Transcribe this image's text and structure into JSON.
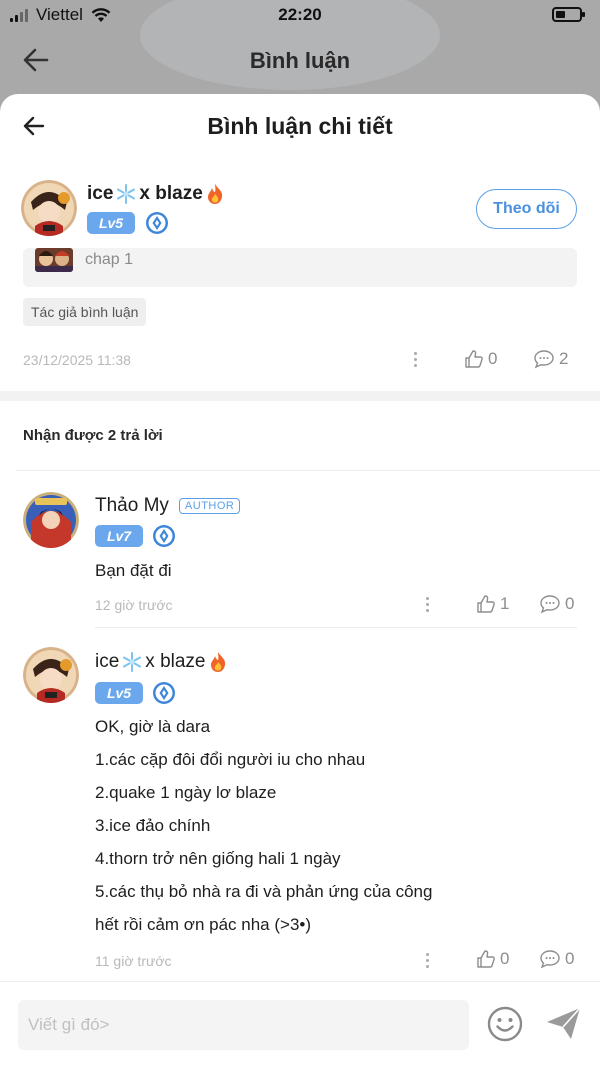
{
  "status_bar": {
    "carrier": "Viettel",
    "time": "22:20"
  },
  "background_page": {
    "title": "Bình luận"
  },
  "sheet": {
    "title": "Bình luận chi tiết"
  },
  "main_comment": {
    "user_name_a": "ice",
    "user_name_b": "x blaze",
    "level": "Lv5",
    "follow_label": "Theo dõi",
    "chapter_text": "chap 1",
    "tag": "Tác giả bình luận",
    "timestamp": "23/12/2025 11:38",
    "likes": "0",
    "replies": "2"
  },
  "replies_header": "Nhận được 2 trả lời",
  "replies": [
    {
      "user_name": "Thảo My",
      "author_badge": "AUTHOR",
      "level": "Lv7",
      "lines": [
        "Bạn đặt đi"
      ],
      "time": "12 giờ trước",
      "likes": "1",
      "replies": "0"
    },
    {
      "user_name_a": "ice",
      "user_name_b": "x blaze",
      "level": "Lv5",
      "lines": [
        "OK, giờ là dara",
        "1.các cặp đôi đổi người iu cho nhau",
        "2.quake 1 ngày lơ blaze",
        "3.ice đảo chính",
        "4.thorn trở nên giống hali 1 ngày",
        "5.các thụ bỏ nhà ra đi và phản ứng của công",
        "hết rồi cảm ơn pác nha (>3•)"
      ],
      "time": "11 giờ trước",
      "likes": "0",
      "replies": "0"
    }
  ],
  "input": {
    "placeholder": "Viết gì đó>"
  },
  "icons": {
    "back": "arrow-left-icon",
    "verify": "blue-crest-icon",
    "like": "thumb-up-icon",
    "comment": "chat-bubble-icon",
    "more": "more-vertical-icon",
    "emoji": "smile-icon",
    "send": "send-icon"
  },
  "colors": {
    "accent": "#5aa0e8",
    "level": "#6aa7ec"
  }
}
